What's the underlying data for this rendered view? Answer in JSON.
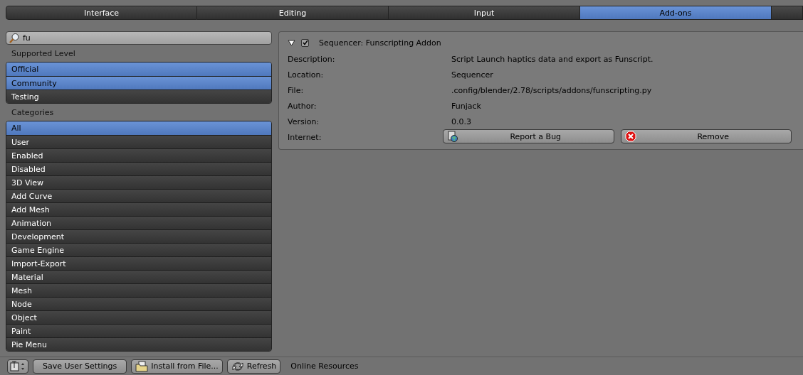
{
  "tabs": [
    {
      "label": "Interface",
      "selected": false
    },
    {
      "label": "Editing",
      "selected": false
    },
    {
      "label": "Input",
      "selected": false
    },
    {
      "label": "Add-ons",
      "selected": true
    }
  ],
  "search": {
    "value": "fu"
  },
  "supported_level": {
    "title": "Supported Level",
    "items": [
      {
        "label": "Official",
        "selected": true
      },
      {
        "label": "Community",
        "selected": true
      },
      {
        "label": "Testing",
        "selected": false
      }
    ]
  },
  "categories": {
    "title": "Categories",
    "items": [
      {
        "label": "All",
        "selected": true
      },
      {
        "label": "User",
        "selected": false
      },
      {
        "label": "Enabled",
        "selected": false
      },
      {
        "label": "Disabled",
        "selected": false
      },
      {
        "label": "3D View",
        "selected": false
      },
      {
        "label": "Add Curve",
        "selected": false
      },
      {
        "label": "Add Mesh",
        "selected": false
      },
      {
        "label": "Animation",
        "selected": false
      },
      {
        "label": "Development",
        "selected": false
      },
      {
        "label": "Game Engine",
        "selected": false
      },
      {
        "label": "Import-Export",
        "selected": false
      },
      {
        "label": "Material",
        "selected": false
      },
      {
        "label": "Mesh",
        "selected": false
      },
      {
        "label": "Node",
        "selected": false
      },
      {
        "label": "Object",
        "selected": false
      },
      {
        "label": "Paint",
        "selected": false
      },
      {
        "label": "Pie Menu",
        "selected": false
      }
    ]
  },
  "addon": {
    "expanded": true,
    "enabled": true,
    "title": "Sequencer: Funscripting Addon",
    "fields": [
      {
        "label": "Description:",
        "value": "Script Launch haptics data and export as Funscript."
      },
      {
        "label": "Location:",
        "value": "Sequencer"
      },
      {
        "label": "File:",
        "value": ".config/blender/2.78/scripts/addons/funscripting.py"
      },
      {
        "label": "Author:",
        "value": "Funjack"
      },
      {
        "label": "Version:",
        "value": "0.0.3"
      }
    ],
    "internet_label": "Internet:",
    "buttons": [
      {
        "kind": "report",
        "label": "Report a Bug"
      },
      {
        "kind": "remove",
        "label": "Remove"
      }
    ]
  },
  "footer": {
    "buttons": [
      {
        "kind": "save",
        "label": "Save User Settings"
      },
      {
        "kind": "install",
        "label": "Install from File..."
      },
      {
        "kind": "refresh",
        "label": "Refresh"
      }
    ],
    "link": "Online Resources"
  }
}
